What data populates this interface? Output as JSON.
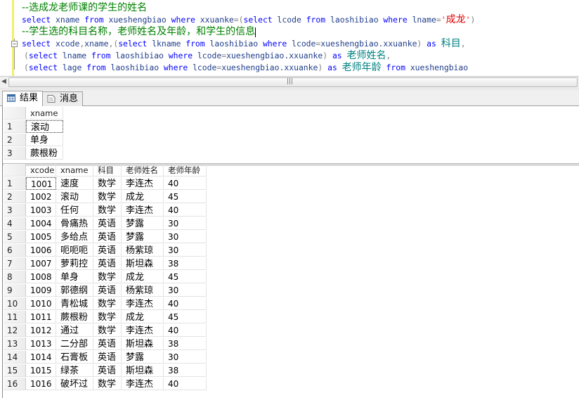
{
  "editor": {
    "lines": [
      [
        [
          "--选成龙老师课的学生的姓名",
          "cm"
        ]
      ],
      [
        [
          "select",
          "kw"
        ],
        [
          " ",
          "id"
        ],
        [
          "xname",
          "id"
        ],
        [
          " ",
          "id"
        ],
        [
          "from",
          "kw"
        ],
        [
          " ",
          "id"
        ],
        [
          "xueshengbiao",
          "id"
        ],
        [
          " ",
          "id"
        ],
        [
          "where",
          "kw"
        ],
        [
          " ",
          "id"
        ],
        [
          "xxuanke",
          "id"
        ],
        [
          "=(",
          "op"
        ],
        [
          "select",
          "kw"
        ],
        [
          " ",
          "id"
        ],
        [
          "lcode",
          "id"
        ],
        [
          " ",
          "id"
        ],
        [
          "from",
          "kw"
        ],
        [
          " ",
          "id"
        ],
        [
          "laoshibiao",
          "id"
        ],
        [
          " ",
          "id"
        ],
        [
          "where",
          "kw"
        ],
        [
          " ",
          "id"
        ],
        [
          "lname",
          "id"
        ],
        [
          "=",
          "op"
        ],
        [
          "'",
          "str"
        ],
        [
          "成龙",
          "strcn"
        ],
        [
          "'",
          "str"
        ],
        [
          ")",
          "op"
        ]
      ],
      [
        [
          "--学生选的科目名称，老师姓名及年龄，和学生的信息",
          "cm"
        ]
      ],
      [
        [
          "select",
          "kw"
        ],
        [
          " ",
          "id"
        ],
        [
          "xcode",
          "id"
        ],
        [
          ",",
          "op"
        ],
        [
          "xname",
          "id"
        ],
        [
          ",(",
          "op"
        ],
        [
          "select",
          "kw"
        ],
        [
          " ",
          "id"
        ],
        [
          "lkname",
          "id"
        ],
        [
          " ",
          "id"
        ],
        [
          "from",
          "kw"
        ],
        [
          " ",
          "id"
        ],
        [
          "laoshibiao",
          "id"
        ],
        [
          " ",
          "id"
        ],
        [
          "where",
          "kw"
        ],
        [
          " ",
          "id"
        ],
        [
          "lcode",
          "id"
        ],
        [
          "=",
          "op"
        ],
        [
          "xueshengbiao.xxuanke",
          "id"
        ],
        [
          ")",
          "op"
        ],
        [
          " ",
          "id"
        ],
        [
          "as",
          "kw"
        ],
        [
          " ",
          "id"
        ],
        [
          "科目",
          "al"
        ],
        [
          ",",
          "op"
        ]
      ],
      [
        [
          "(",
          "op"
        ],
        [
          "select",
          "kw"
        ],
        [
          " ",
          "id"
        ],
        [
          "lname",
          "id"
        ],
        [
          " ",
          "id"
        ],
        [
          "from",
          "kw"
        ],
        [
          " ",
          "id"
        ],
        [
          "laoshibiao",
          "id"
        ],
        [
          " ",
          "id"
        ],
        [
          "where",
          "kw"
        ],
        [
          " ",
          "id"
        ],
        [
          "lcode",
          "id"
        ],
        [
          "=",
          "op"
        ],
        [
          "xueshengbiao.xxuanke",
          "id"
        ],
        [
          ")",
          "op"
        ],
        [
          " ",
          "id"
        ],
        [
          "as",
          "kw"
        ],
        [
          " ",
          "id"
        ],
        [
          "老师姓名",
          "al"
        ],
        [
          ",",
          "op"
        ]
      ],
      [
        [
          "(",
          "op"
        ],
        [
          "select",
          "kw"
        ],
        [
          " ",
          "id"
        ],
        [
          "lage",
          "id"
        ],
        [
          " ",
          "id"
        ],
        [
          "from",
          "kw"
        ],
        [
          " ",
          "id"
        ],
        [
          "laoshibiao",
          "id"
        ],
        [
          " ",
          "id"
        ],
        [
          "where",
          "kw"
        ],
        [
          " ",
          "id"
        ],
        [
          "lcode",
          "id"
        ],
        [
          "=",
          "op"
        ],
        [
          "xueshengbiao.xxuanke",
          "id"
        ],
        [
          ")",
          "op"
        ],
        [
          " ",
          "id"
        ],
        [
          "as",
          "kw"
        ],
        [
          " ",
          "id"
        ],
        [
          "老师年龄",
          "al"
        ],
        [
          " ",
          "id"
        ],
        [
          "from",
          "kw"
        ],
        [
          " ",
          "id"
        ],
        [
          "xueshengbiao",
          "id"
        ]
      ]
    ]
  },
  "tabs": [
    {
      "label": "结果",
      "icon": "grid-icon",
      "active": true
    },
    {
      "label": "消息",
      "icon": "message-icon",
      "active": false
    }
  ],
  "grid1": {
    "columns": [
      "xname"
    ],
    "rows": [
      [
        "1",
        "滚动"
      ],
      [
        "2",
        "单身"
      ],
      [
        "3",
        "蕨根粉"
      ]
    ]
  },
  "grid2": {
    "columns": [
      "xcode",
      "xname",
      "科目",
      "老师姓名",
      "老师年龄"
    ],
    "rows": [
      [
        "1",
        "1001",
        "速度",
        "数学",
        "李连杰",
        "40"
      ],
      [
        "2",
        "1002",
        "滚动",
        "数学",
        "成龙",
        "45"
      ],
      [
        "3",
        "1003",
        "任何",
        "数学",
        "李连杰",
        "40"
      ],
      [
        "4",
        "1004",
        "骨痛热",
        "英语",
        "梦露",
        "30"
      ],
      [
        "5",
        "1005",
        "多给点",
        "英语",
        "梦露",
        "30"
      ],
      [
        "6",
        "1006",
        "呃呃呃",
        "英语",
        "杨紫琼",
        "30"
      ],
      [
        "7",
        "1007",
        "萝莉控",
        "英语",
        "斯坦森",
        "38"
      ],
      [
        "8",
        "1008",
        "单身",
        "数学",
        "成龙",
        "45"
      ],
      [
        "9",
        "1009",
        "郭德纲",
        "英语",
        "杨紫琼",
        "30"
      ],
      [
        "10",
        "1010",
        "青松城",
        "数学",
        "李连杰",
        "40"
      ],
      [
        "11",
        "1011",
        "蕨根粉",
        "数学",
        "成龙",
        "45"
      ],
      [
        "12",
        "1012",
        "通过",
        "数学",
        "李连杰",
        "40"
      ],
      [
        "13",
        "1013",
        "二分部",
        "英语",
        "斯坦森",
        "38"
      ],
      [
        "14",
        "1014",
        "石膏板",
        "英语",
        "梦露",
        "30"
      ],
      [
        "15",
        "1015",
        "绿茶",
        "英语",
        "斯坦森",
        "38"
      ],
      [
        "16",
        "1016",
        "破坏过",
        "数学",
        "李连杰",
        "40"
      ]
    ]
  }
}
